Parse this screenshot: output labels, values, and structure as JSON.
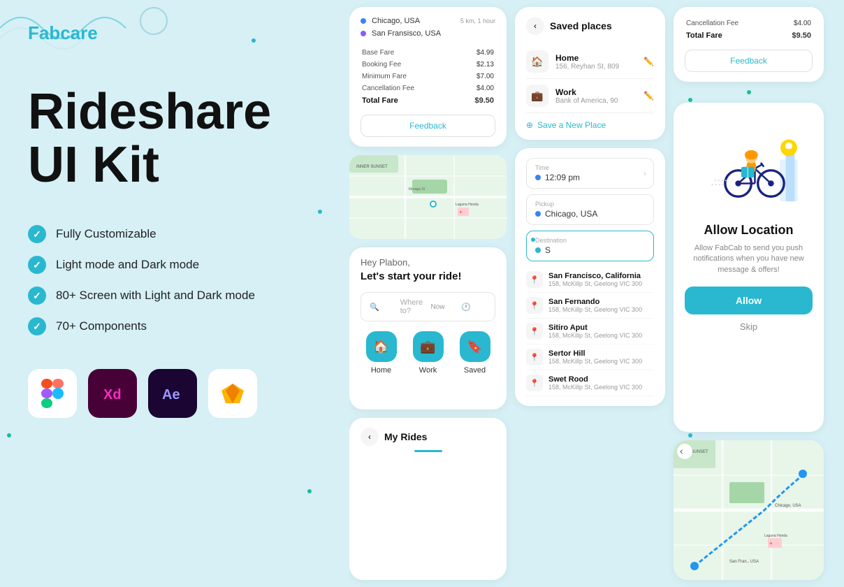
{
  "brand": {
    "name": "Fabcare",
    "color": "#29b8d0"
  },
  "hero": {
    "title_line1": "Rideshare",
    "title_line2": "UI Kit"
  },
  "features": [
    "Fully Customizable",
    "Light mode and Dark mode",
    "80+ Screen with Light and Dark mode",
    "70+ Components"
  ],
  "tools": [
    {
      "name": "Figma",
      "class": "tool-figma"
    },
    {
      "name": "XD",
      "class": "tool-xd"
    },
    {
      "name": "AE",
      "class": "tool-ae"
    },
    {
      "name": "Sketch",
      "class": "tool-sketch"
    }
  ],
  "fare_card": {
    "from": "Chicago, USA",
    "to": "San Fransisco, USA",
    "distance": "5 km, 1 hour",
    "rows": [
      {
        "label": "Base Fare",
        "value": "$4.99"
      },
      {
        "label": "Booking Fee",
        "value": "$2.13"
      },
      {
        "label": "Minimum Fare",
        "value": "$7.00"
      },
      {
        "label": "Cancellation Fee",
        "value": "$4.00"
      },
      {
        "label": "Total Fare",
        "value": "$9.50"
      }
    ],
    "feedback_label": "Feedback"
  },
  "home_screen": {
    "greeting": "Hey Plabon,",
    "subtitle": "Let's start your ride!",
    "search_placeholder": "Where to?",
    "time_label": "Now",
    "shortcuts": [
      {
        "label": "Home",
        "icon": "🏠"
      },
      {
        "label": "Work",
        "icon": "💼"
      },
      {
        "label": "Saved",
        "icon": "🔖"
      }
    ]
  },
  "saved_places": {
    "title": "Saved places",
    "back_label": "‹",
    "places": [
      {
        "name": "Home",
        "address": "156, Reyhan SI, 809",
        "icon": "🏠"
      },
      {
        "name": "Work",
        "address": "Bank of America, 90",
        "icon": "💼"
      }
    ],
    "save_new_label": "Save a New Place"
  },
  "location_input": {
    "time_label": "Time",
    "time_value": "12:09 pm",
    "pickup_label": "Pickup",
    "pickup_value": "Chicago, USA",
    "destination_label": "Destination",
    "destination_value": "S",
    "results": [
      {
        "name": "San Francisco, California",
        "address": "158, McKillp St, Geelong VIC 300"
      },
      {
        "name": "San Fernando",
        "address": "158, McKillp St, Geelong VIC 300"
      },
      {
        "name": "Sitiro Aput",
        "address": "158, McKillp St, Geelong VIC 300"
      },
      {
        "name": "Sertor Hill",
        "address": "158, McKillp St, Geelong VIC 300"
      },
      {
        "name": "Swet Rood",
        "address": "158, McKillp St, Geelong VIC 300"
      }
    ]
  },
  "allow_location": {
    "title": "Allow Location",
    "description": "Allow FabCab to send you push notifications when you have new message & offers!",
    "allow_label": "Allow",
    "skip_label": "Skip"
  },
  "my_rides": {
    "title": "My Rides"
  },
  "fare_card_right": {
    "rows": [
      {
        "label": "Cancellation Fee",
        "value": "$4.00"
      },
      {
        "label": "Total Fare",
        "value": "$9.50"
      }
    ],
    "feedback_label": "Feedback"
  }
}
